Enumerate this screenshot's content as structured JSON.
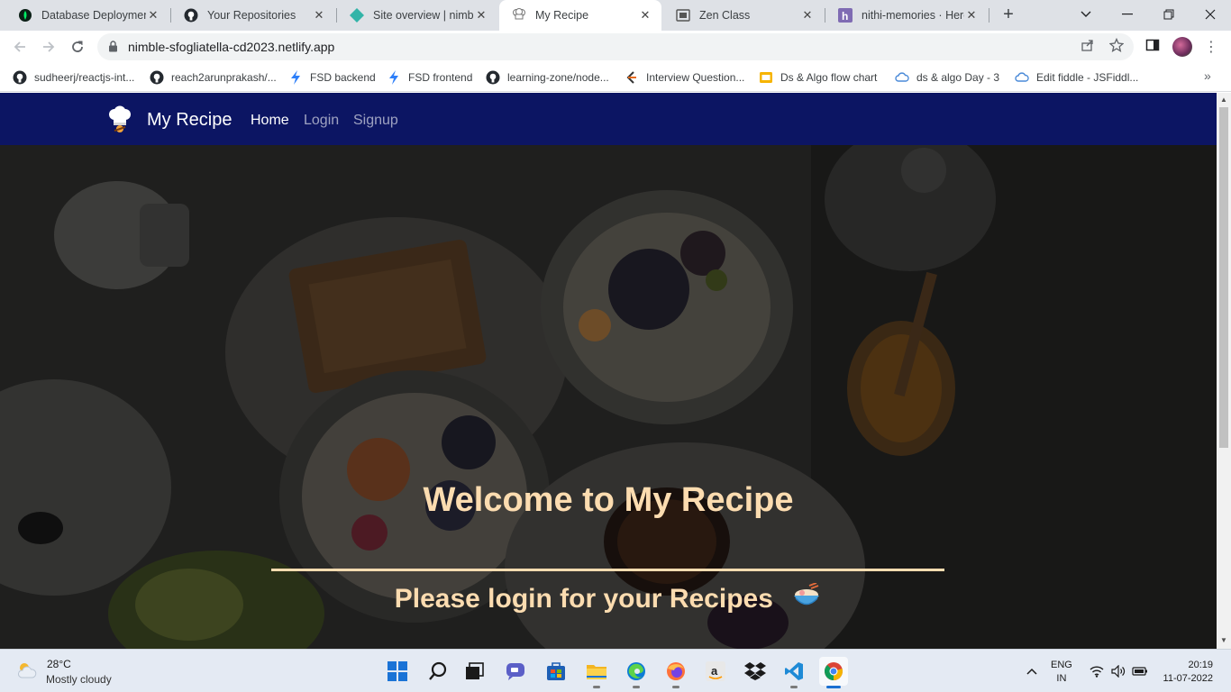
{
  "browser": {
    "tabs": [
      {
        "title": "Database Deployments",
        "icon": "mongodb-leaf-icon",
        "active": false
      },
      {
        "title": "Your Repositories",
        "icon": "github-icon",
        "active": false
      },
      {
        "title": "Site overview | nimble",
        "icon": "netlify-icon",
        "active": false
      },
      {
        "title": "My Recipe",
        "icon": "chef-hat-icon",
        "active": true
      },
      {
        "title": "Zen Class",
        "icon": "zen-class-icon",
        "active": false
      },
      {
        "title": "nithi-memories · Hero",
        "icon": "heroku-icon",
        "active": false
      }
    ],
    "new_tab": "+",
    "url": "nimble-sfogliatella-cd2023.netlify.app",
    "bookmarks": [
      {
        "label": "sudheerj/reactjs-int...",
        "icon": "github-icon"
      },
      {
        "label": "reach2arunprakash/...",
        "icon": "github-icon"
      },
      {
        "label": "FSD backend",
        "icon": "bolt-icon"
      },
      {
        "label": "FSD frontend",
        "icon": "bolt-icon"
      },
      {
        "label": "learning-zone/node...",
        "icon": "github-icon"
      },
      {
        "label": "Interview Question...",
        "icon": "interview-icon"
      },
      {
        "label": "Ds & Algo flow chart",
        "icon": "slides-icon"
      },
      {
        "label": "ds & algo Day - 3",
        "icon": "cloud-icon"
      },
      {
        "label": "Edit fiddle - JSFiddl...",
        "icon": "cloud-icon"
      }
    ],
    "bookmarks_more": "»"
  },
  "page": {
    "brand": "My Recipe",
    "nav": [
      {
        "label": "Home",
        "active": true
      },
      {
        "label": "Login",
        "active": false
      },
      {
        "label": "Signup",
        "active": false
      }
    ],
    "hero_title": "Welcome to My Recipe",
    "hero_subtitle": "Please login for your Recipes",
    "accent_color": "#fcdcb0",
    "navbar_color": "#0c1563"
  },
  "taskbar": {
    "weather_temp": "28°C",
    "weather_condition": "Mostly cloudy",
    "apps": [
      "windows-start-icon",
      "search-icon",
      "task-view-icon",
      "chat-icon",
      "store-icon",
      "file-explorer-icon",
      "edge-icon",
      "firefox-icon",
      "amazon-icon",
      "dropbox-icon",
      "vscode-icon",
      "chrome-icon"
    ],
    "lang_top": "ENG",
    "lang_bottom": "IN",
    "time": "20:19",
    "date": "11-07-2022"
  }
}
